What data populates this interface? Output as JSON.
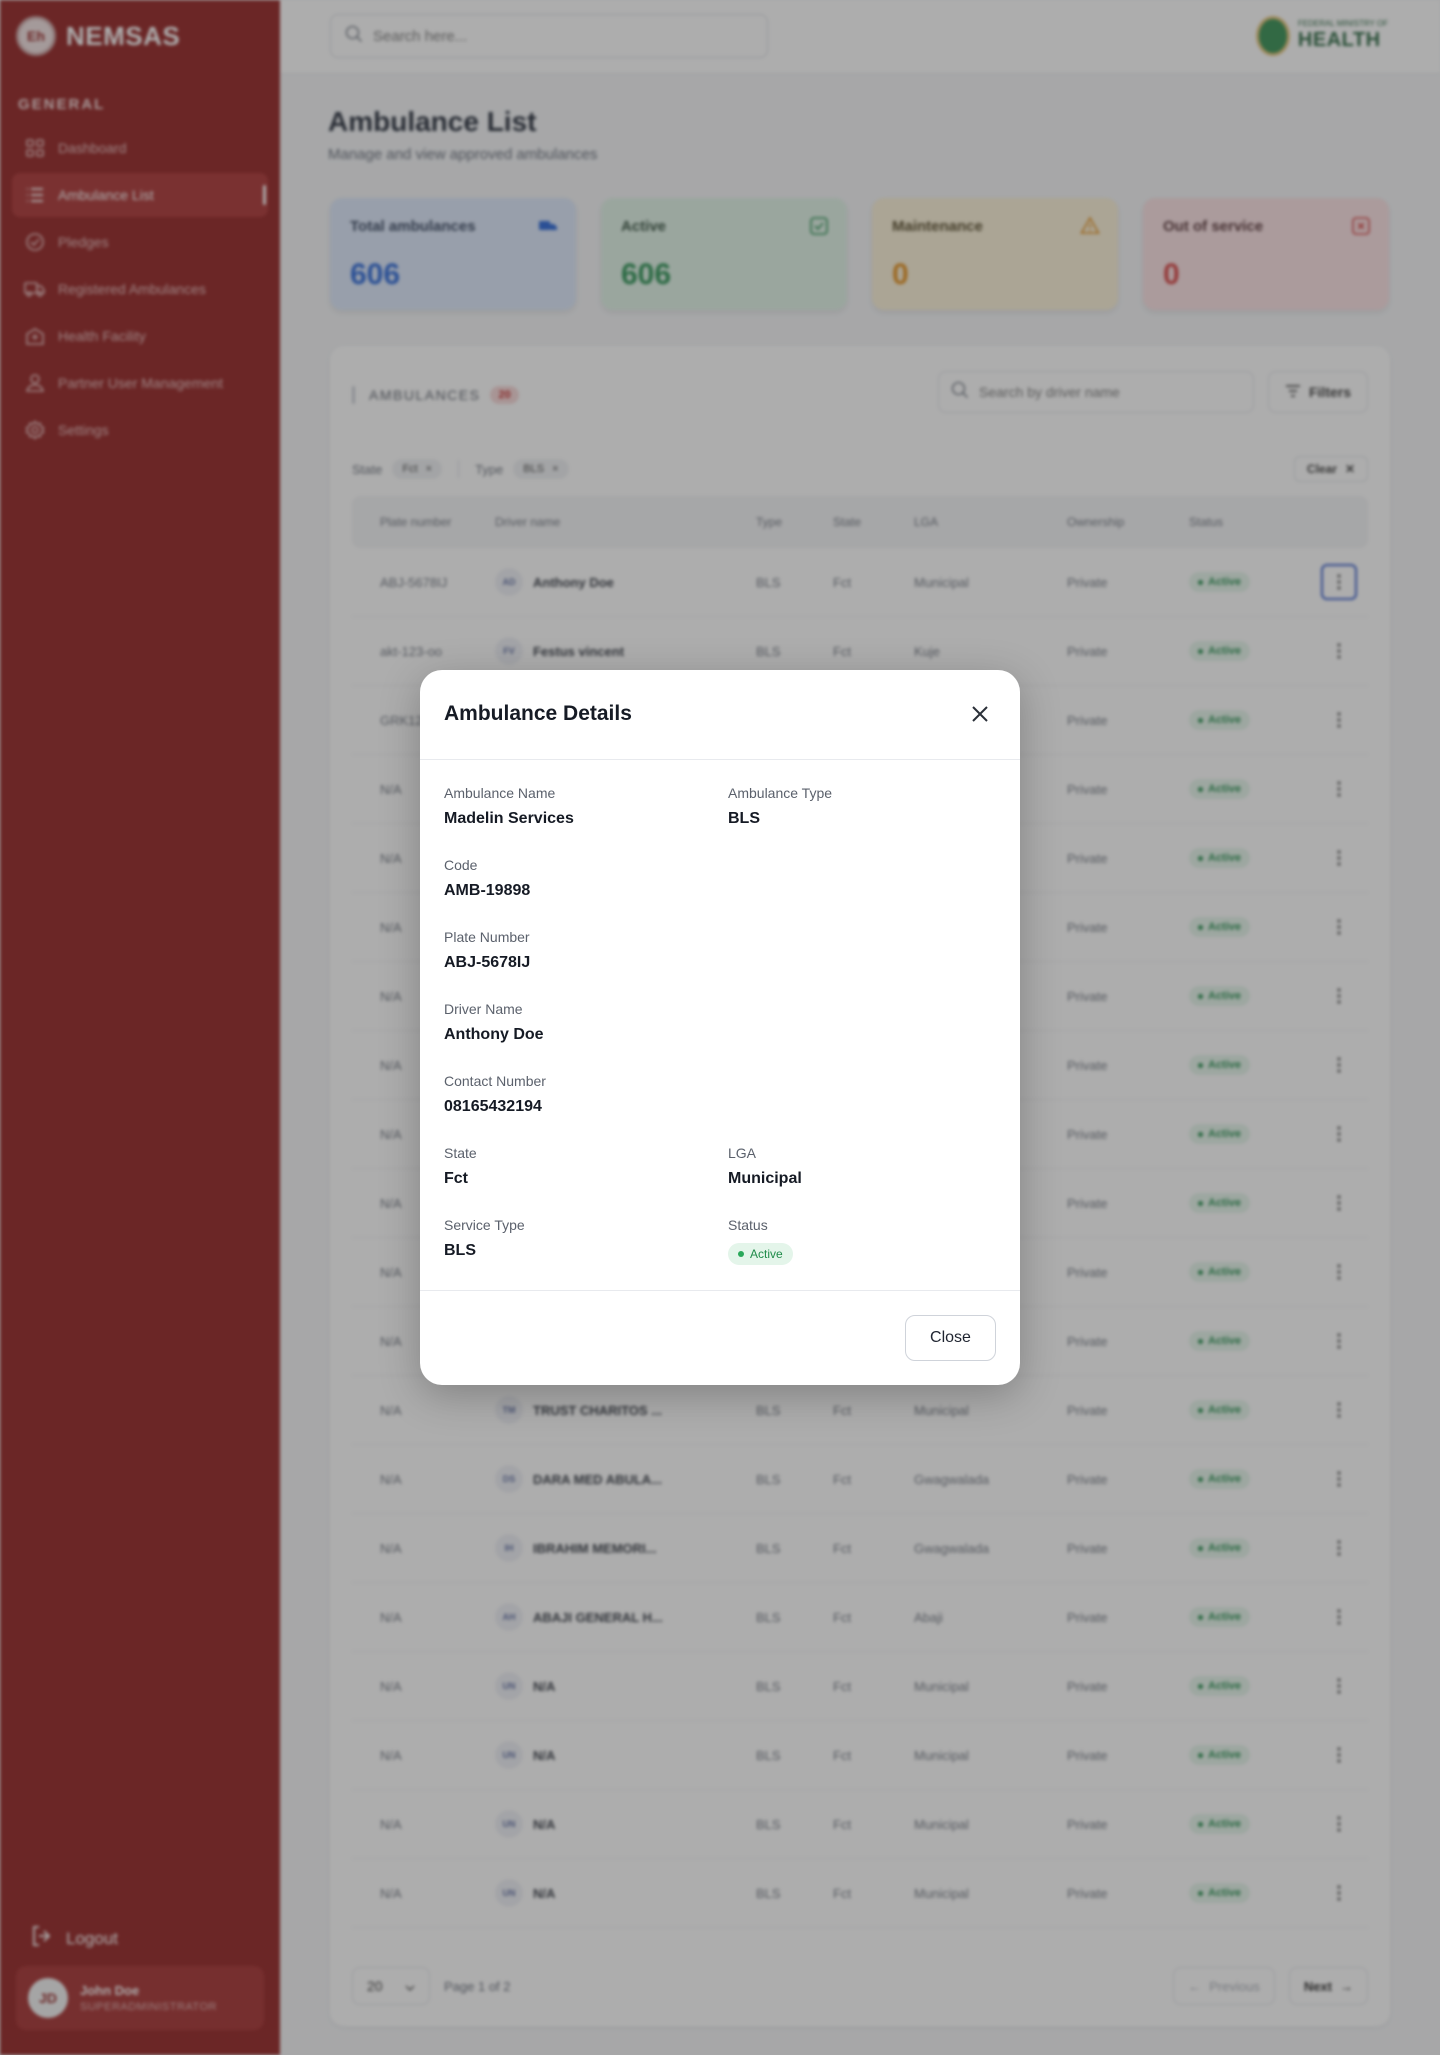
{
  "sidebar": {
    "logo_text": "NEMSAS",
    "logo_mark": "Eh",
    "section_label": "GENERAL",
    "items": [
      {
        "label": "Dashboard",
        "icon": "grid-icon"
      },
      {
        "label": "Ambulance List",
        "icon": "list-icon",
        "active": true
      },
      {
        "label": "Pledges",
        "icon": "check-circle-icon"
      },
      {
        "label": "Registered Ambulances",
        "icon": "ambulance-icon"
      },
      {
        "label": "Health Facility",
        "icon": "hospital-icon"
      },
      {
        "label": "Partner User Management",
        "icon": "user-icon"
      },
      {
        "label": "Settings",
        "icon": "gear-icon"
      }
    ],
    "logout_label": "Logout",
    "user": {
      "initials": "JD",
      "name": "John Doe",
      "role": "SUPERADMINISTRATOR"
    }
  },
  "header": {
    "search_placeholder": "Search here...",
    "brand_small": "FEDERAL MINISTRY OF",
    "brand_big": "HEALTH"
  },
  "page": {
    "title": "Ambulance List",
    "subtitle": "Manage and view approved ambulances"
  },
  "stats": [
    {
      "label": "Total ambulances",
      "value": "606"
    },
    {
      "label": "Active",
      "value": "606"
    },
    {
      "label": "Maintenance",
      "value": "0"
    },
    {
      "label": "Out of service",
      "value": "0"
    }
  ],
  "list": {
    "title": "AMBULANCES",
    "count": "20",
    "search_placeholder": "Search by driver name",
    "filters_label": "Filters",
    "filter_state_label": "State",
    "filter_state_value": "Fct",
    "filter_type_label": "Type",
    "filter_type_value": "BLS",
    "clear_label": "Clear",
    "columns": [
      "Plate number",
      "Driver name",
      "Type",
      "State",
      "LGA",
      "Ownership",
      "Status"
    ],
    "rows": [
      {
        "plate": "ABJ-5678IJ",
        "initials": "AD",
        "driver": "Anthony Doe",
        "type": "BLS",
        "state": "Fct",
        "lga": "Municipal",
        "ownership": "Private",
        "status": "Active"
      },
      {
        "plate": "akt-123-oo",
        "initials": "FV",
        "driver": "Festus vincent",
        "type": "BLS",
        "state": "Fct",
        "lga": "Kuje",
        "ownership": "Private",
        "status": "Active"
      },
      {
        "plate": "GRK12",
        "initials": "",
        "driver": "",
        "type": "",
        "state": "",
        "lga": "",
        "ownership": "Private",
        "status": "Active"
      },
      {
        "plate": "N/A",
        "initials": "",
        "driver": "",
        "type": "",
        "state": "",
        "lga": "",
        "ownership": "Private",
        "status": "Active"
      },
      {
        "plate": "N/A",
        "initials": "",
        "driver": "",
        "type": "",
        "state": "",
        "lga": "",
        "ownership": "Private",
        "status": "Active"
      },
      {
        "plate": "N/A",
        "initials": "",
        "driver": "",
        "type": "",
        "state": "",
        "lga": "",
        "ownership": "Private",
        "status": "Active"
      },
      {
        "plate": "N/A",
        "initials": "",
        "driver": "",
        "type": "",
        "state": "",
        "lga": "",
        "ownership": "Private",
        "status": "Active"
      },
      {
        "plate": "N/A",
        "initials": "",
        "driver": "",
        "type": "",
        "state": "",
        "lga": "",
        "ownership": "Private",
        "status": "Active"
      },
      {
        "plate": "N/A",
        "initials": "",
        "driver": "",
        "type": "",
        "state": "",
        "lga": "",
        "ownership": "Private",
        "status": "Active"
      },
      {
        "plate": "N/A",
        "initials": "",
        "driver": "",
        "type": "",
        "state": "",
        "lga": "",
        "ownership": "Private",
        "status": "Active"
      },
      {
        "plate": "N/A",
        "initials": "",
        "driver": "",
        "type": "",
        "state": "",
        "lga": "",
        "ownership": "Private",
        "status": "Active"
      },
      {
        "plate": "N/A",
        "initials": "",
        "driver": "",
        "type": "",
        "state": "",
        "lga": "",
        "ownership": "Private",
        "status": "Active"
      },
      {
        "plate": "N/A",
        "initials": "TM",
        "driver": "TRUST CHARITOS ...",
        "type": "BLS",
        "state": "Fct",
        "lga": "Municipal",
        "ownership": "Private",
        "status": "Active"
      },
      {
        "plate": "N/A",
        "initials": "DS",
        "driver": "DARA MED ABULA...",
        "type": "BLS",
        "state": "Fct",
        "lga": "Gwagwalada",
        "ownership": "Private",
        "status": "Active"
      },
      {
        "plate": "N/A",
        "initials": "IH",
        "driver": "IBRAHIM MEMORI...",
        "type": "BLS",
        "state": "Fct",
        "lga": "Gwagwalada",
        "ownership": "Private",
        "status": "Active"
      },
      {
        "plate": "N/A",
        "initials": "AH",
        "driver": "ABAJI GENERAL H...",
        "type": "BLS",
        "state": "Fct",
        "lga": "Abaji",
        "ownership": "Private",
        "status": "Active"
      },
      {
        "plate": "N/A",
        "initials": "UN",
        "driver": "N/A",
        "type": "BLS",
        "state": "Fct",
        "lga": "Municipal",
        "ownership": "Private",
        "status": "Active"
      },
      {
        "plate": "N/A",
        "initials": "UN",
        "driver": "N/A",
        "type": "BLS",
        "state": "Fct",
        "lga": "Municipal",
        "ownership": "Private",
        "status": "Active"
      },
      {
        "plate": "N/A",
        "initials": "UN",
        "driver": "N/A",
        "type": "BLS",
        "state": "Fct",
        "lga": "Municipal",
        "ownership": "Private",
        "status": "Active"
      },
      {
        "plate": "N/A",
        "initials": "UN",
        "driver": "N/A",
        "type": "BLS",
        "state": "Fct",
        "lga": "Municipal",
        "ownership": "Private",
        "status": "Active"
      }
    ],
    "pagination": {
      "per_page": "20",
      "page_info": "Page 1 of 2",
      "previous_label": "Previous",
      "next_label": "Next"
    }
  },
  "modal": {
    "title": "Ambulance Details",
    "fields": {
      "ambulance_name_label": "Ambulance Name",
      "ambulance_name": "Madelin Services",
      "ambulance_type_label": "Ambulance Type",
      "ambulance_type": "BLS",
      "code_label": "Code",
      "code": "AMB-19898",
      "plate_label": "Plate Number",
      "plate": "ABJ-5678IJ",
      "driver_label": "Driver Name",
      "driver": "Anthony Doe",
      "contact_label": "Contact Number",
      "contact": "08165432194",
      "state_label": "State",
      "state": "Fct",
      "lga_label": "LGA",
      "lga": "Municipal",
      "service_label": "Service Type",
      "service": "BLS",
      "status_label": "Status",
      "status": "Active"
    },
    "close_label": "Close"
  },
  "colors": {
    "sidebar_bg": "#8e1717",
    "accent_blue": "#1f5fd6",
    "success_green": "#1f8b49",
    "warning_orange": "#e28a12",
    "danger_red": "#d53a3a"
  }
}
